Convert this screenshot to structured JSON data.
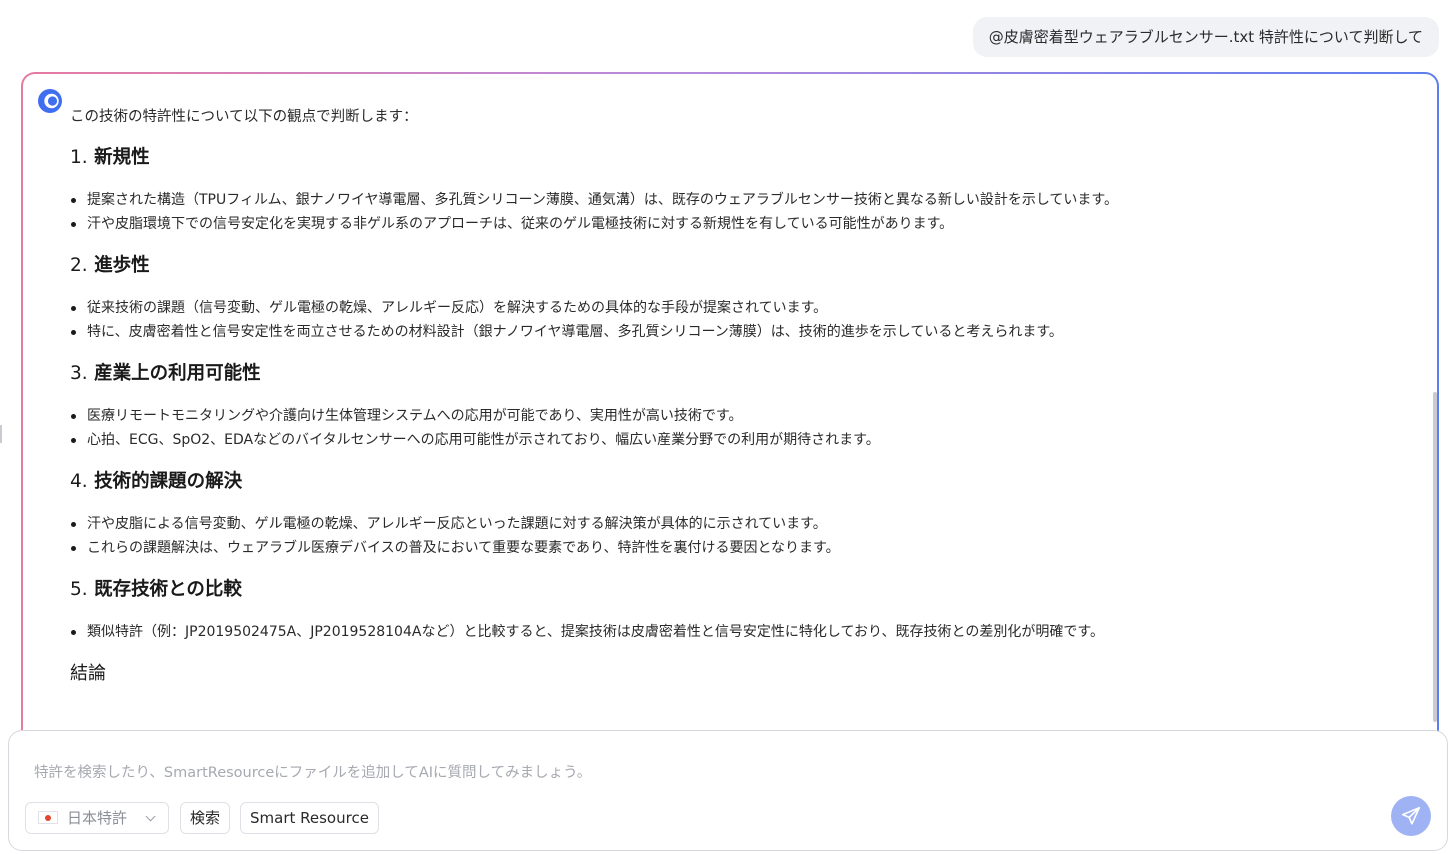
{
  "user_message": "@皮膚密着型ウェアラブルセンサー.txt 特許性について判断して",
  "answer": {
    "intro": "この技術の特許性について以下の観点で判断します：",
    "sections": [
      {
        "number": "1.",
        "title": "新規性",
        "bullets": [
          "提案された構造（TPUフィルム、銀ナノワイヤ導電層、多孔質シリコーン薄膜、通気溝）は、既存のウェアラブルセンサー技術と異なる新しい設計を示しています。",
          "汗や皮脂環境下での信号安定化を実現する非ゲル系のアプローチは、従来のゲル電極技術に対する新規性を有している可能性があります。"
        ]
      },
      {
        "number": "2.",
        "title": "進歩性",
        "bullets": [
          "従来技術の課題（信号変動、ゲル電極の乾燥、アレルギー反応）を解決するための具体的な手段が提案されています。",
          "特に、皮膚密着性と信号安定性を両立させるための材料設計（銀ナノワイヤ導電層、多孔質シリコーン薄膜）は、技術的進歩を示していると考えられます。"
        ]
      },
      {
        "number": "3.",
        "title": "産業上の利用可能性",
        "bullets": [
          "医療リモートモニタリングや介護向け生体管理システムへの応用が可能であり、実用性が高い技術です。",
          "心拍、ECG、SpO2、EDAなどのバイタルセンサーへの応用可能性が示されており、幅広い産業分野での利用が期待されます。"
        ]
      },
      {
        "number": "4.",
        "title": "技術的課題の解決",
        "bullets": [
          "汗や皮脂による信号変動、ゲル電極の乾燥、アレルギー反応といった課題に対する解決策が具体的に示されています。",
          "これらの課題解決は、ウェアラブル医療デバイスの普及において重要な要素であり、特許性を裏付ける要因となります。"
        ]
      },
      {
        "number": "5.",
        "title": "既存技術との比較",
        "bullets": [
          "類似特許（例：JP2019502475A、JP2019528104Aなど）と比較すると、提案技術は皮膚密着性と信号安定性に特化しており、既存技術との差別化が明確です。"
        ]
      }
    ],
    "conclusion": "結論"
  },
  "composer": {
    "placeholder": "特許を検索したり、SmartResourceにファイルを追加してAIに質問してみましょう。",
    "country_label": "日本特許",
    "search_label": "検索",
    "resource_label": "Smart Resource"
  },
  "colors": {
    "card_gradient_start": "#e57aa3",
    "card_gradient_end": "#5c7ef0",
    "send_button": "#9fb2f4",
    "flag_red": "#e5452f"
  },
  "icons": {
    "ai_logo": "ai-logo-icon",
    "flag": "japan-flag-icon",
    "dropdown": "chevron-down-icon",
    "send": "send-icon"
  }
}
